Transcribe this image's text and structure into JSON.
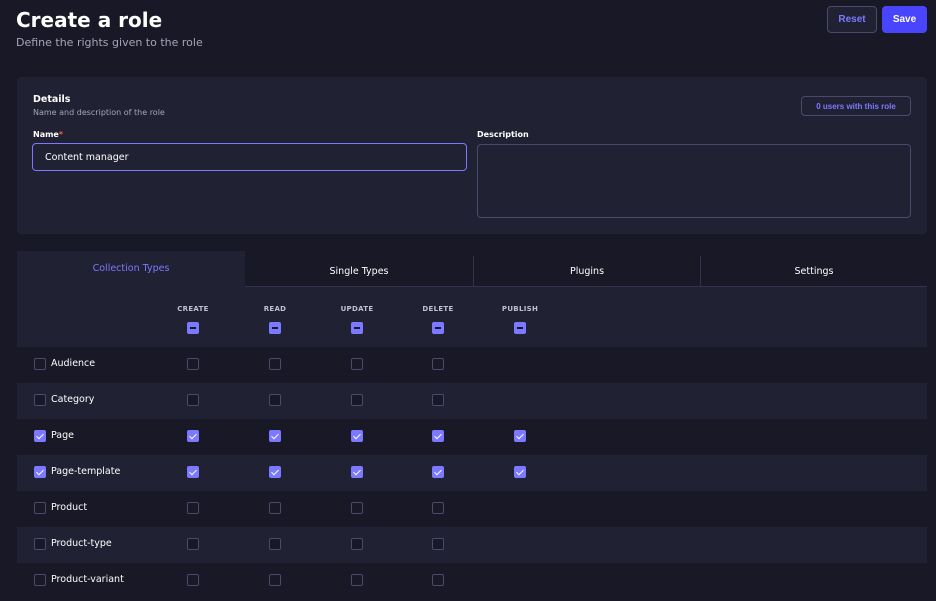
{
  "header": {
    "title": "Create a role",
    "subtitle": "Define the rights given to the role",
    "reset_label": "Reset",
    "save_label": "Save"
  },
  "details": {
    "title": "Details",
    "subtitle": "Name and description of the role",
    "users_button": "0 users with this role",
    "name_label": "Name",
    "name_required_mark": "*",
    "name_value": "Content manager",
    "description_label": "Description",
    "description_value": ""
  },
  "tabs": [
    {
      "label": "Collection Types",
      "active": true
    },
    {
      "label": "Single Types",
      "active": false
    },
    {
      "label": "Plugins",
      "active": false
    },
    {
      "label": "Settings",
      "active": false
    }
  ],
  "permissions": {
    "columns": [
      "CREATE",
      "READ",
      "UPDATE",
      "DELETE",
      "PUBLISH"
    ],
    "rows": [
      {
        "label": "Audience",
        "selected": false,
        "create": false,
        "read": false,
        "update": false,
        "delete": false,
        "publish": null
      },
      {
        "label": "Category",
        "selected": false,
        "create": false,
        "read": false,
        "update": false,
        "delete": false,
        "publish": null
      },
      {
        "label": "Page",
        "selected": true,
        "create": true,
        "read": true,
        "update": true,
        "delete": true,
        "publish": true
      },
      {
        "label": "Page-template",
        "selected": true,
        "create": true,
        "read": true,
        "update": true,
        "delete": true,
        "publish": true
      },
      {
        "label": "Product",
        "selected": false,
        "create": false,
        "read": false,
        "update": false,
        "delete": false,
        "publish": null
      },
      {
        "label": "Product-type",
        "selected": false,
        "create": false,
        "read": false,
        "update": false,
        "delete": false,
        "publish": null
      },
      {
        "label": "Product-variant",
        "selected": false,
        "create": false,
        "read": false,
        "update": false,
        "delete": false,
        "publish": null
      }
    ]
  },
  "colors": {
    "background": "#181826",
    "panel": "#212134",
    "accent": "#7b79ff",
    "primary_button": "#4945ff",
    "border": "#4a4a6a",
    "required": "#ee5e52"
  }
}
